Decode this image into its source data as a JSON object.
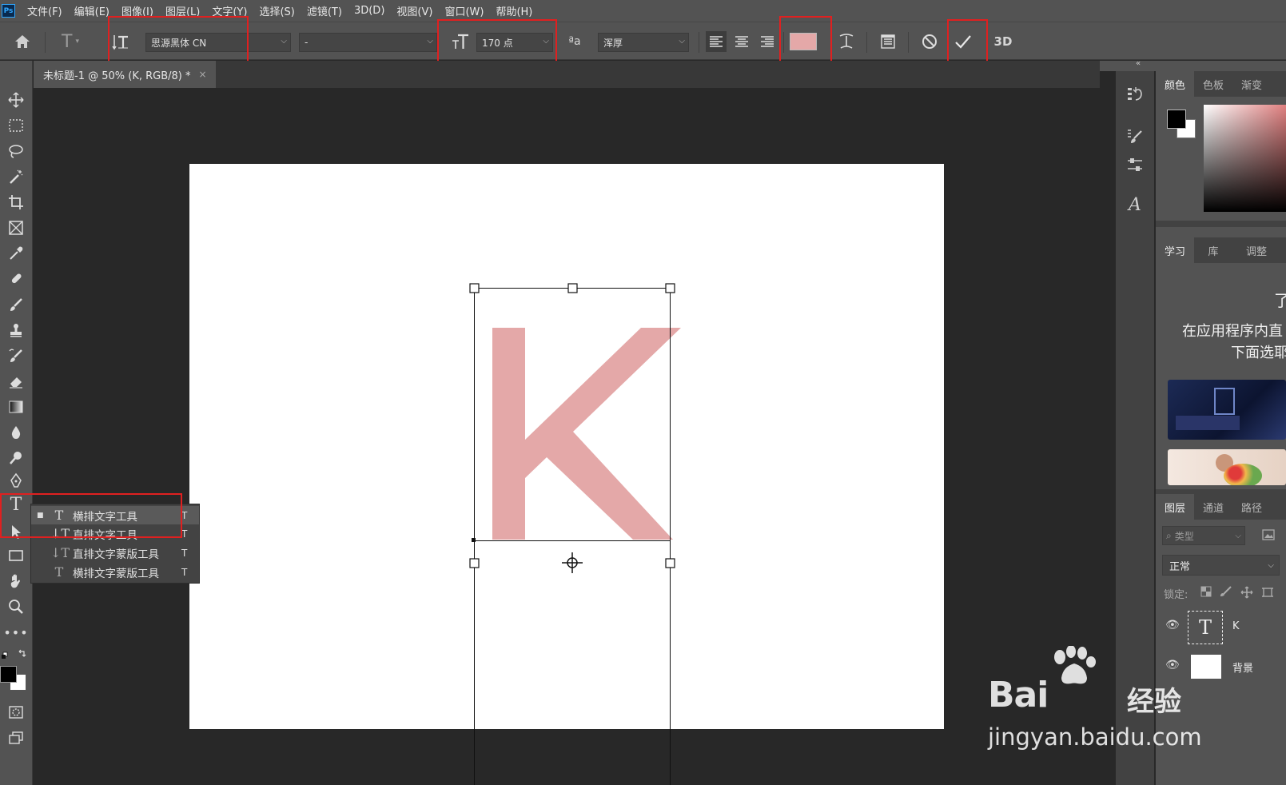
{
  "menu": [
    "文件(F)",
    "编辑(E)",
    "图像(I)",
    "图层(L)",
    "文字(Y)",
    "选择(S)",
    "滤镜(T)",
    "3D(D)",
    "视图(V)",
    "窗口(W)",
    "帮助(H)"
  ],
  "app_logo": "Ps",
  "options": {
    "font_family": "思源黑体 CN",
    "font_style": "-",
    "font_size": "170 点",
    "aa_label": "ªa",
    "antialias": "浑厚",
    "text_color": "#e4a8a8",
    "threed_label": "3D"
  },
  "document": {
    "tab_title": "未标题-1 @ 50% (K, RGB/8) *",
    "close": "×",
    "text": "K",
    "text_color": "#e4a8a8"
  },
  "flyout": [
    {
      "label": "横排文字工具",
      "key": "T",
      "active": true
    },
    {
      "label": "直排文字工具",
      "key": "T",
      "active": false
    },
    {
      "label": "直排文字蒙版工具",
      "key": "T",
      "active": false
    },
    {
      "label": "横排文字蒙版工具",
      "key": "T",
      "active": false
    }
  ],
  "panels": {
    "color_tabs": [
      "颜色",
      "色板",
      "渐变"
    ],
    "learn_tabs": [
      "学习",
      "库",
      "调整"
    ],
    "learn_heading": "了",
    "learn_text_1": "在应用程序内直",
    "learn_text_2": "下面选耶",
    "layers_tabs": [
      "图层",
      "通道",
      "路径"
    ],
    "search_placeholder": "类型",
    "blend_mode": "正常",
    "lock_label": "锁定:",
    "layers": [
      {
        "name": "K",
        "type": "text"
      },
      {
        "name": "背景",
        "type": "background"
      }
    ]
  },
  "watermark": {
    "brand": "Bai",
    "brand_suffix": "经验",
    "url": "jingyan.baidu.com"
  }
}
